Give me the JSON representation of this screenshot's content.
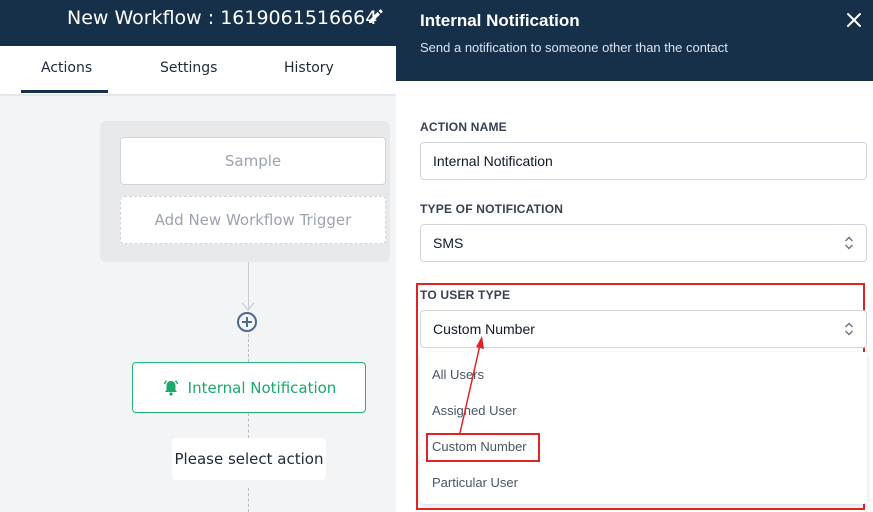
{
  "workflow": {
    "title": "New Workflow : 1619061516664",
    "tabs": [
      {
        "label": "Actions",
        "active": true
      },
      {
        "label": "Settings",
        "active": false
      },
      {
        "label": "History",
        "active": false
      }
    ]
  },
  "canvas": {
    "triggers": [
      {
        "label": "Sample"
      },
      {
        "label": "Add New Workflow Trigger"
      }
    ],
    "action_node": {
      "label": "Internal Notification",
      "icon": "bell-icon"
    },
    "select_action": {
      "label": "Please select action"
    }
  },
  "drawer": {
    "title": "Internal Notification",
    "subtitle": "Send a notification to someone other than the contact",
    "fields": {
      "action_name": {
        "label": "ACTION NAME",
        "value": "Internal Notification"
      },
      "type_of_notification": {
        "label": "TYPE OF NOTIFICATION",
        "value": "SMS"
      },
      "to_user_type": {
        "label": "TO USER TYPE",
        "value": "Custom Number",
        "options": [
          "All Users",
          "Assigned User",
          "Custom Number",
          "Particular User"
        ]
      }
    }
  },
  "colors": {
    "header": "#16304a",
    "accent_green": "#22b573",
    "annotation_red": "#e02424"
  }
}
